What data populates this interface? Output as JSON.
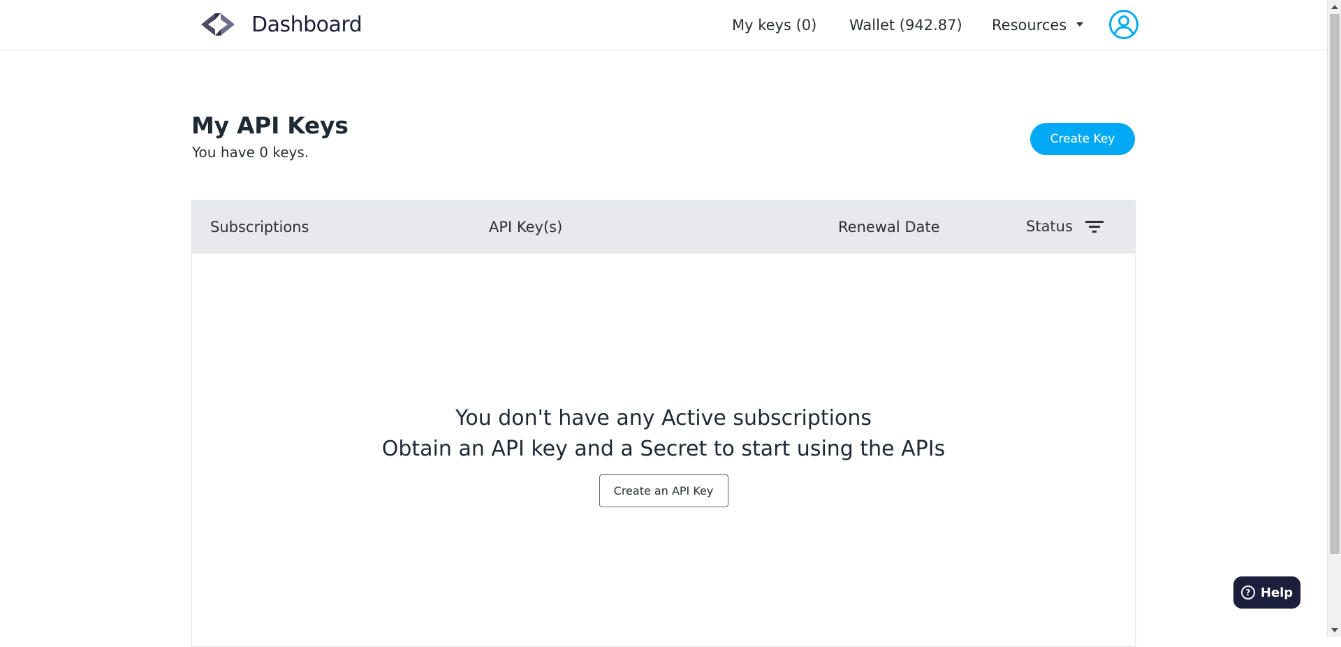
{
  "header": {
    "brand_title": "Dashboard",
    "nav": {
      "my_keys": "My keys (0)",
      "wallet": "Wallet (942.87)",
      "resources": "Resources"
    }
  },
  "page": {
    "title": "My API Keys",
    "subtitle": "You have 0 keys.",
    "create_key_label": "Create Key"
  },
  "table": {
    "columns": [
      "Subscriptions",
      "API Key(s)",
      "Renewal Date",
      "Status"
    ]
  },
  "empty_state": {
    "line1": "You don't have any Active subscriptions",
    "line2": "Obtain an API key and a Secret to start using the APIs",
    "cta_label": "Create an API Key"
  },
  "help": {
    "icon": "?",
    "label": "Help"
  },
  "colors": {
    "accent": "#03a9f4",
    "brand_dark": "#1b1f3b",
    "table_header_bg": "#e8e9ed"
  },
  "icons": {
    "logo": "code-brackets-logo",
    "avatar": "user-circle-icon",
    "filter": "filter-lines-icon",
    "dropdown": "caret-down-icon"
  }
}
